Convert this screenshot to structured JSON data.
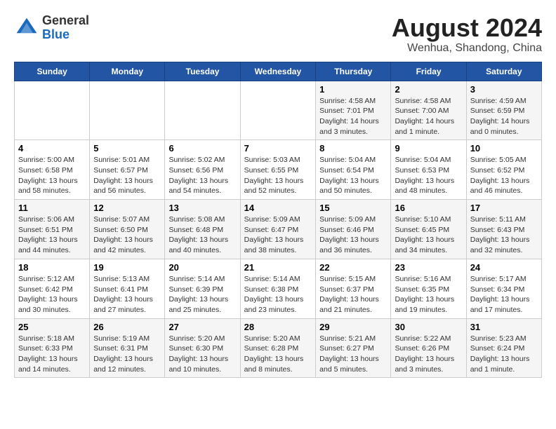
{
  "header": {
    "logo_general": "General",
    "logo_blue": "Blue",
    "month_year": "August 2024",
    "location": "Wenhua, Shandong, China"
  },
  "days_of_week": [
    "Sunday",
    "Monday",
    "Tuesday",
    "Wednesday",
    "Thursday",
    "Friday",
    "Saturday"
  ],
  "weeks": [
    [
      {
        "day": "",
        "info": ""
      },
      {
        "day": "",
        "info": ""
      },
      {
        "day": "",
        "info": ""
      },
      {
        "day": "",
        "info": ""
      },
      {
        "day": "1",
        "info": "Sunrise: 4:58 AM\nSunset: 7:01 PM\nDaylight: 14 hours\nand 3 minutes."
      },
      {
        "day": "2",
        "info": "Sunrise: 4:58 AM\nSunset: 7:00 AM\nDaylight: 14 hours\nand 1 minute."
      },
      {
        "day": "3",
        "info": "Sunrise: 4:59 AM\nSunset: 6:59 PM\nDaylight: 14 hours\nand 0 minutes."
      }
    ],
    [
      {
        "day": "4",
        "info": "Sunrise: 5:00 AM\nSunset: 6:58 PM\nDaylight: 13 hours\nand 58 minutes."
      },
      {
        "day": "5",
        "info": "Sunrise: 5:01 AM\nSunset: 6:57 PM\nDaylight: 13 hours\nand 56 minutes."
      },
      {
        "day": "6",
        "info": "Sunrise: 5:02 AM\nSunset: 6:56 PM\nDaylight: 13 hours\nand 54 minutes."
      },
      {
        "day": "7",
        "info": "Sunrise: 5:03 AM\nSunset: 6:55 PM\nDaylight: 13 hours\nand 52 minutes."
      },
      {
        "day": "8",
        "info": "Sunrise: 5:04 AM\nSunset: 6:54 PM\nDaylight: 13 hours\nand 50 minutes."
      },
      {
        "day": "9",
        "info": "Sunrise: 5:04 AM\nSunset: 6:53 PM\nDaylight: 13 hours\nand 48 minutes."
      },
      {
        "day": "10",
        "info": "Sunrise: 5:05 AM\nSunset: 6:52 PM\nDaylight: 13 hours\nand 46 minutes."
      }
    ],
    [
      {
        "day": "11",
        "info": "Sunrise: 5:06 AM\nSunset: 6:51 PM\nDaylight: 13 hours\nand 44 minutes."
      },
      {
        "day": "12",
        "info": "Sunrise: 5:07 AM\nSunset: 6:50 PM\nDaylight: 13 hours\nand 42 minutes."
      },
      {
        "day": "13",
        "info": "Sunrise: 5:08 AM\nSunset: 6:48 PM\nDaylight: 13 hours\nand 40 minutes."
      },
      {
        "day": "14",
        "info": "Sunrise: 5:09 AM\nSunset: 6:47 PM\nDaylight: 13 hours\nand 38 minutes."
      },
      {
        "day": "15",
        "info": "Sunrise: 5:09 AM\nSunset: 6:46 PM\nDaylight: 13 hours\nand 36 minutes."
      },
      {
        "day": "16",
        "info": "Sunrise: 5:10 AM\nSunset: 6:45 PM\nDaylight: 13 hours\nand 34 minutes."
      },
      {
        "day": "17",
        "info": "Sunrise: 5:11 AM\nSunset: 6:43 PM\nDaylight: 13 hours\nand 32 minutes."
      }
    ],
    [
      {
        "day": "18",
        "info": "Sunrise: 5:12 AM\nSunset: 6:42 PM\nDaylight: 13 hours\nand 30 minutes."
      },
      {
        "day": "19",
        "info": "Sunrise: 5:13 AM\nSunset: 6:41 PM\nDaylight: 13 hours\nand 27 minutes."
      },
      {
        "day": "20",
        "info": "Sunrise: 5:14 AM\nSunset: 6:39 PM\nDaylight: 13 hours\nand 25 minutes."
      },
      {
        "day": "21",
        "info": "Sunrise: 5:14 AM\nSunset: 6:38 PM\nDaylight: 13 hours\nand 23 minutes."
      },
      {
        "day": "22",
        "info": "Sunrise: 5:15 AM\nSunset: 6:37 PM\nDaylight: 13 hours\nand 21 minutes."
      },
      {
        "day": "23",
        "info": "Sunrise: 5:16 AM\nSunset: 6:35 PM\nDaylight: 13 hours\nand 19 minutes."
      },
      {
        "day": "24",
        "info": "Sunrise: 5:17 AM\nSunset: 6:34 PM\nDaylight: 13 hours\nand 17 minutes."
      }
    ],
    [
      {
        "day": "25",
        "info": "Sunrise: 5:18 AM\nSunset: 6:33 PM\nDaylight: 13 hours\nand 14 minutes."
      },
      {
        "day": "26",
        "info": "Sunrise: 5:19 AM\nSunset: 6:31 PM\nDaylight: 13 hours\nand 12 minutes."
      },
      {
        "day": "27",
        "info": "Sunrise: 5:20 AM\nSunset: 6:30 PM\nDaylight: 13 hours\nand 10 minutes."
      },
      {
        "day": "28",
        "info": "Sunrise: 5:20 AM\nSunset: 6:28 PM\nDaylight: 13 hours\nand 8 minutes."
      },
      {
        "day": "29",
        "info": "Sunrise: 5:21 AM\nSunset: 6:27 PM\nDaylight: 13 hours\nand 5 minutes."
      },
      {
        "day": "30",
        "info": "Sunrise: 5:22 AM\nSunset: 6:26 PM\nDaylight: 13 hours\nand 3 minutes."
      },
      {
        "day": "31",
        "info": "Sunrise: 5:23 AM\nSunset: 6:24 PM\nDaylight: 13 hours\nand 1 minute."
      }
    ]
  ]
}
